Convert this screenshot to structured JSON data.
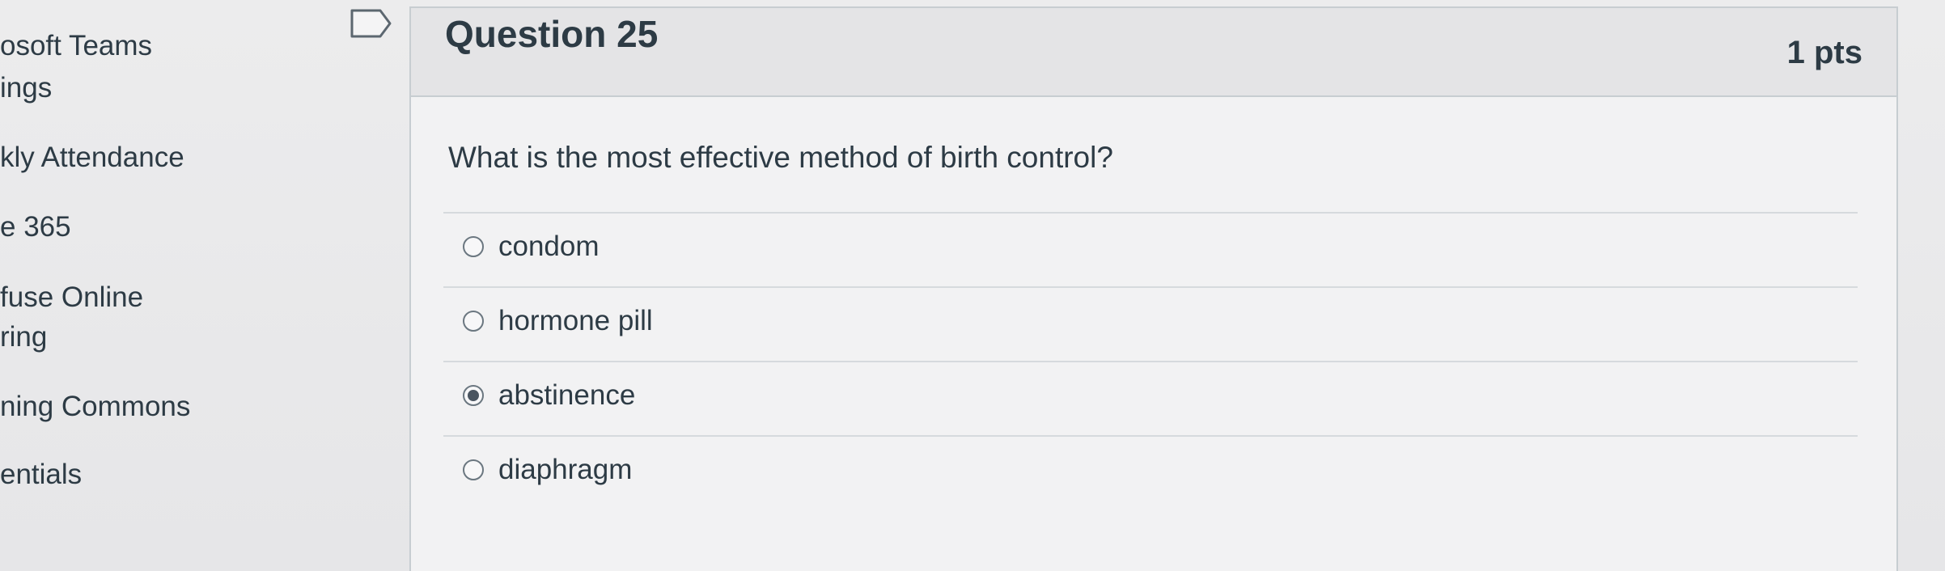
{
  "sidebar": {
    "items": [
      {
        "label": "osoft Teams"
      },
      {
        "label": "ings"
      },
      {
        "label": "kly Attendance"
      },
      {
        "label": "e 365"
      },
      {
        "label": "fuse Online"
      },
      {
        "label": "ring"
      },
      {
        "label": "ning Commons"
      },
      {
        "label": "entials"
      }
    ]
  },
  "question": {
    "title": "Question 25",
    "points": "1 pts",
    "text": "What is the most effective method of birth control?",
    "answers": [
      {
        "label": "condom",
        "selected": false
      },
      {
        "label": "hormone pill",
        "selected": false
      },
      {
        "label": "abstinence",
        "selected": true
      },
      {
        "label": "diaphragm",
        "selected": false
      }
    ]
  },
  "icons": {
    "flag": "flag-icon"
  }
}
